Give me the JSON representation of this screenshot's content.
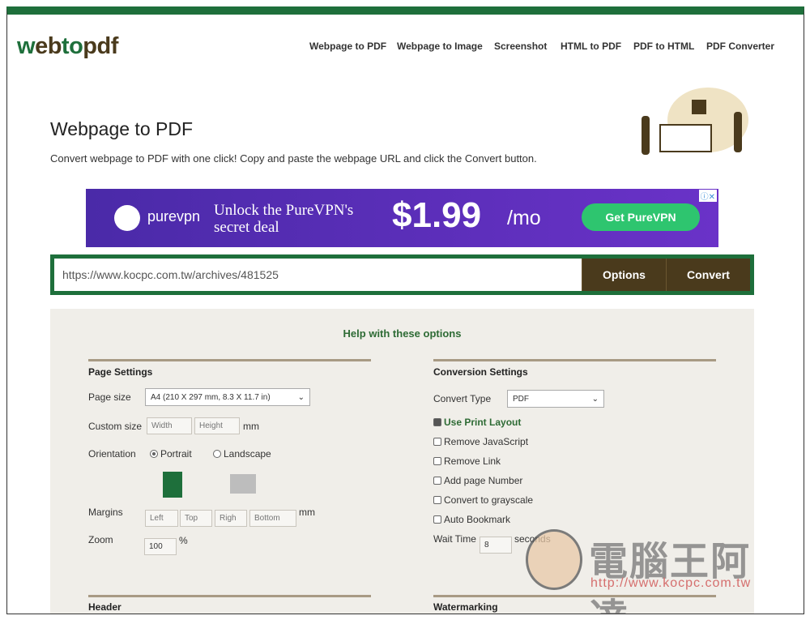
{
  "logo": "webtopdf",
  "nav": [
    "Webpage to PDF",
    "Webpage to Image",
    "Screenshot",
    "HTML to PDF",
    "PDF to HTML",
    "PDF Converter"
  ],
  "title": "Webpage to PDF",
  "subtitle": "Convert webpage to PDF with one click! Copy and paste the webpage URL and click the Convert button.",
  "ad": {
    "brand": "purevpn",
    "headline": "Unlock the PureVPN's secret deal",
    "price": "$1.99",
    "unit": "/mo",
    "cta": "Get PureVPN"
  },
  "url": {
    "value": "https://www.kocpc.com.tw/archives/481525"
  },
  "buttons": {
    "options": "Options",
    "convert": "Convert"
  },
  "help": "Help with these options",
  "page_settings": {
    "title": "Page Settings",
    "page_size_label": "Page size",
    "page_size": "A4 (210 X 297 mm, 8.3 X 11.7 in)",
    "custom_size_label": "Custom size",
    "width_ph": "Width",
    "height_ph": "Height",
    "mm": "mm",
    "orientation_label": "Orientation",
    "portrait": "Portrait",
    "landscape": "Landscape",
    "margins_label": "Margins",
    "left_ph": "Left",
    "top_ph": "Top",
    "right_ph": "Righ",
    "bottom_ph": "Bottom",
    "zoom_label": "Zoom",
    "zoom": "100",
    "percent": "%"
  },
  "conversion": {
    "title": "Conversion Settings",
    "type_label": "Convert Type",
    "type": "PDF",
    "options": [
      {
        "label": "Use Print Layout",
        "checked": true
      },
      {
        "label": "Remove JavaScript",
        "checked": false
      },
      {
        "label": "Remove Link",
        "checked": false
      },
      {
        "label": "Add page Number",
        "checked": false
      },
      {
        "label": "Convert to grayscale",
        "checked": false
      },
      {
        "label": "Auto Bookmark",
        "checked": false
      }
    ],
    "wait_label": "Wait Time",
    "wait": "8",
    "seconds": "seconds"
  },
  "header_title": "Header",
  "watermark_title": "Watermarking",
  "watermark": {
    "name": "電腦王阿達",
    "url": "http://www.kocpc.com.tw"
  },
  "colors": {
    "green": "#1e6f3b",
    "brown": "#4a3a1c",
    "panel": "#f0eee9"
  }
}
